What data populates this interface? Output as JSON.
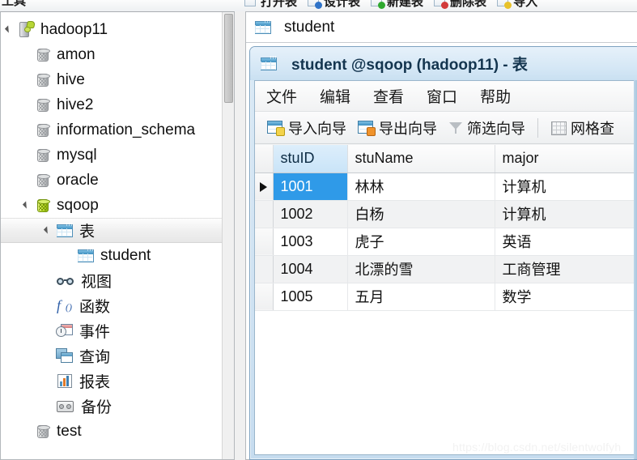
{
  "app_toolbar": {
    "clipped_left_label": "工具",
    "buttons": [
      {
        "label": "打开表",
        "icon": "open-table-icon",
        "badge": "badge-none"
      },
      {
        "label": "设计表",
        "icon": "design-table-icon",
        "badge": "badge-blue"
      },
      {
        "label": "新建表",
        "icon": "new-table-icon",
        "badge": "badge-green"
      },
      {
        "label": "删除表",
        "icon": "delete-table-icon",
        "badge": "badge-red"
      },
      {
        "label": "导入",
        "icon": "import-table-icon",
        "badge": "badge-yellow"
      }
    ]
  },
  "sidebar": {
    "scrollbar": {
      "name": "sidebar-vertical-scrollbar"
    },
    "items": [
      {
        "label": "hadoop11",
        "icon": "server-icon",
        "indent": 0,
        "twisty": "open",
        "selected": false
      },
      {
        "label": "amon",
        "icon": "database-icon",
        "indent": 1,
        "twisty": "none",
        "selected": false
      },
      {
        "label": "hive",
        "icon": "database-icon",
        "indent": 1,
        "twisty": "none",
        "selected": false
      },
      {
        "label": "hive2",
        "icon": "database-icon",
        "indent": 1,
        "twisty": "none",
        "selected": false
      },
      {
        "label": "information_schema",
        "icon": "database-icon",
        "indent": 1,
        "twisty": "none",
        "selected": false
      },
      {
        "label": "mysql",
        "icon": "database-icon",
        "indent": 1,
        "twisty": "none",
        "selected": false
      },
      {
        "label": "oracle",
        "icon": "database-icon",
        "indent": 1,
        "twisty": "none",
        "selected": false
      },
      {
        "label": "sqoop",
        "icon": "database-active-icon",
        "indent": 1,
        "twisty": "open",
        "selected": false
      },
      {
        "label": "表",
        "icon": "table-folder-icon",
        "indent": 2,
        "twisty": "open",
        "selected": true
      },
      {
        "label": "student",
        "icon": "table-icon",
        "indent": 3,
        "twisty": "none",
        "selected": false
      },
      {
        "label": "视图",
        "icon": "view-icon",
        "indent": 2,
        "twisty": "none",
        "selected": false
      },
      {
        "label": "函数",
        "icon": "function-icon",
        "indent": 2,
        "twisty": "none",
        "selected": false
      },
      {
        "label": "事件",
        "icon": "event-icon",
        "indent": 2,
        "twisty": "none",
        "selected": false
      },
      {
        "label": "查询",
        "icon": "query-icon",
        "indent": 2,
        "twisty": "none",
        "selected": false
      },
      {
        "label": "报表",
        "icon": "report-icon",
        "indent": 2,
        "twisty": "none",
        "selected": false
      },
      {
        "label": "备份",
        "icon": "backup-icon",
        "indent": 2,
        "twisty": "none",
        "selected": false
      },
      {
        "label": "test",
        "icon": "database-icon",
        "indent": 1,
        "twisty": "none",
        "selected": false
      }
    ]
  },
  "document_tab": {
    "label": "student",
    "icon": "table-icon"
  },
  "child_window": {
    "title": "student @sqoop (hadoop11) - 表",
    "title_icon": "table-icon",
    "menu": [
      {
        "label": "文件"
      },
      {
        "label": "编辑"
      },
      {
        "label": "查看"
      },
      {
        "label": "窗口"
      },
      {
        "label": "帮助"
      }
    ],
    "toolbar": [
      {
        "label": "导入向导",
        "icon": "import-wizard-icon",
        "arrow": "arrow-in"
      },
      {
        "label": "导出向导",
        "icon": "export-wizard-icon",
        "arrow": "arrow-out"
      },
      {
        "label": "筛选向导",
        "icon": "filter-wizard-icon",
        "arrow": ""
      },
      {
        "label": "网格查",
        "icon": "grid-view-icon",
        "arrow": ""
      }
    ]
  },
  "grid": {
    "columns": [
      "stuID",
      "stuName",
      "major"
    ],
    "selected_column": "stuID",
    "selected_row_index": 0,
    "rows": [
      {
        "stuID": "1001",
        "stuName": "林林",
        "major": "计算机"
      },
      {
        "stuID": "1002",
        "stuName": "白杨",
        "major": "计算机"
      },
      {
        "stuID": "1003",
        "stuName": "虎子",
        "major": "英语"
      },
      {
        "stuID": "1004",
        "stuName": "北漂的雪",
        "major": "工商管理"
      },
      {
        "stuID": "1005",
        "stuName": "五月",
        "major": "数学"
      }
    ]
  },
  "watermark": {
    "text": "https://blog.csdn.net/silentwolfyh"
  },
  "colors": {
    "selection_blue": "#2f9ae8",
    "header_selected": "#c9e4f8",
    "title_bar": "#d3e6f5",
    "tree_selected": "#efefef"
  }
}
